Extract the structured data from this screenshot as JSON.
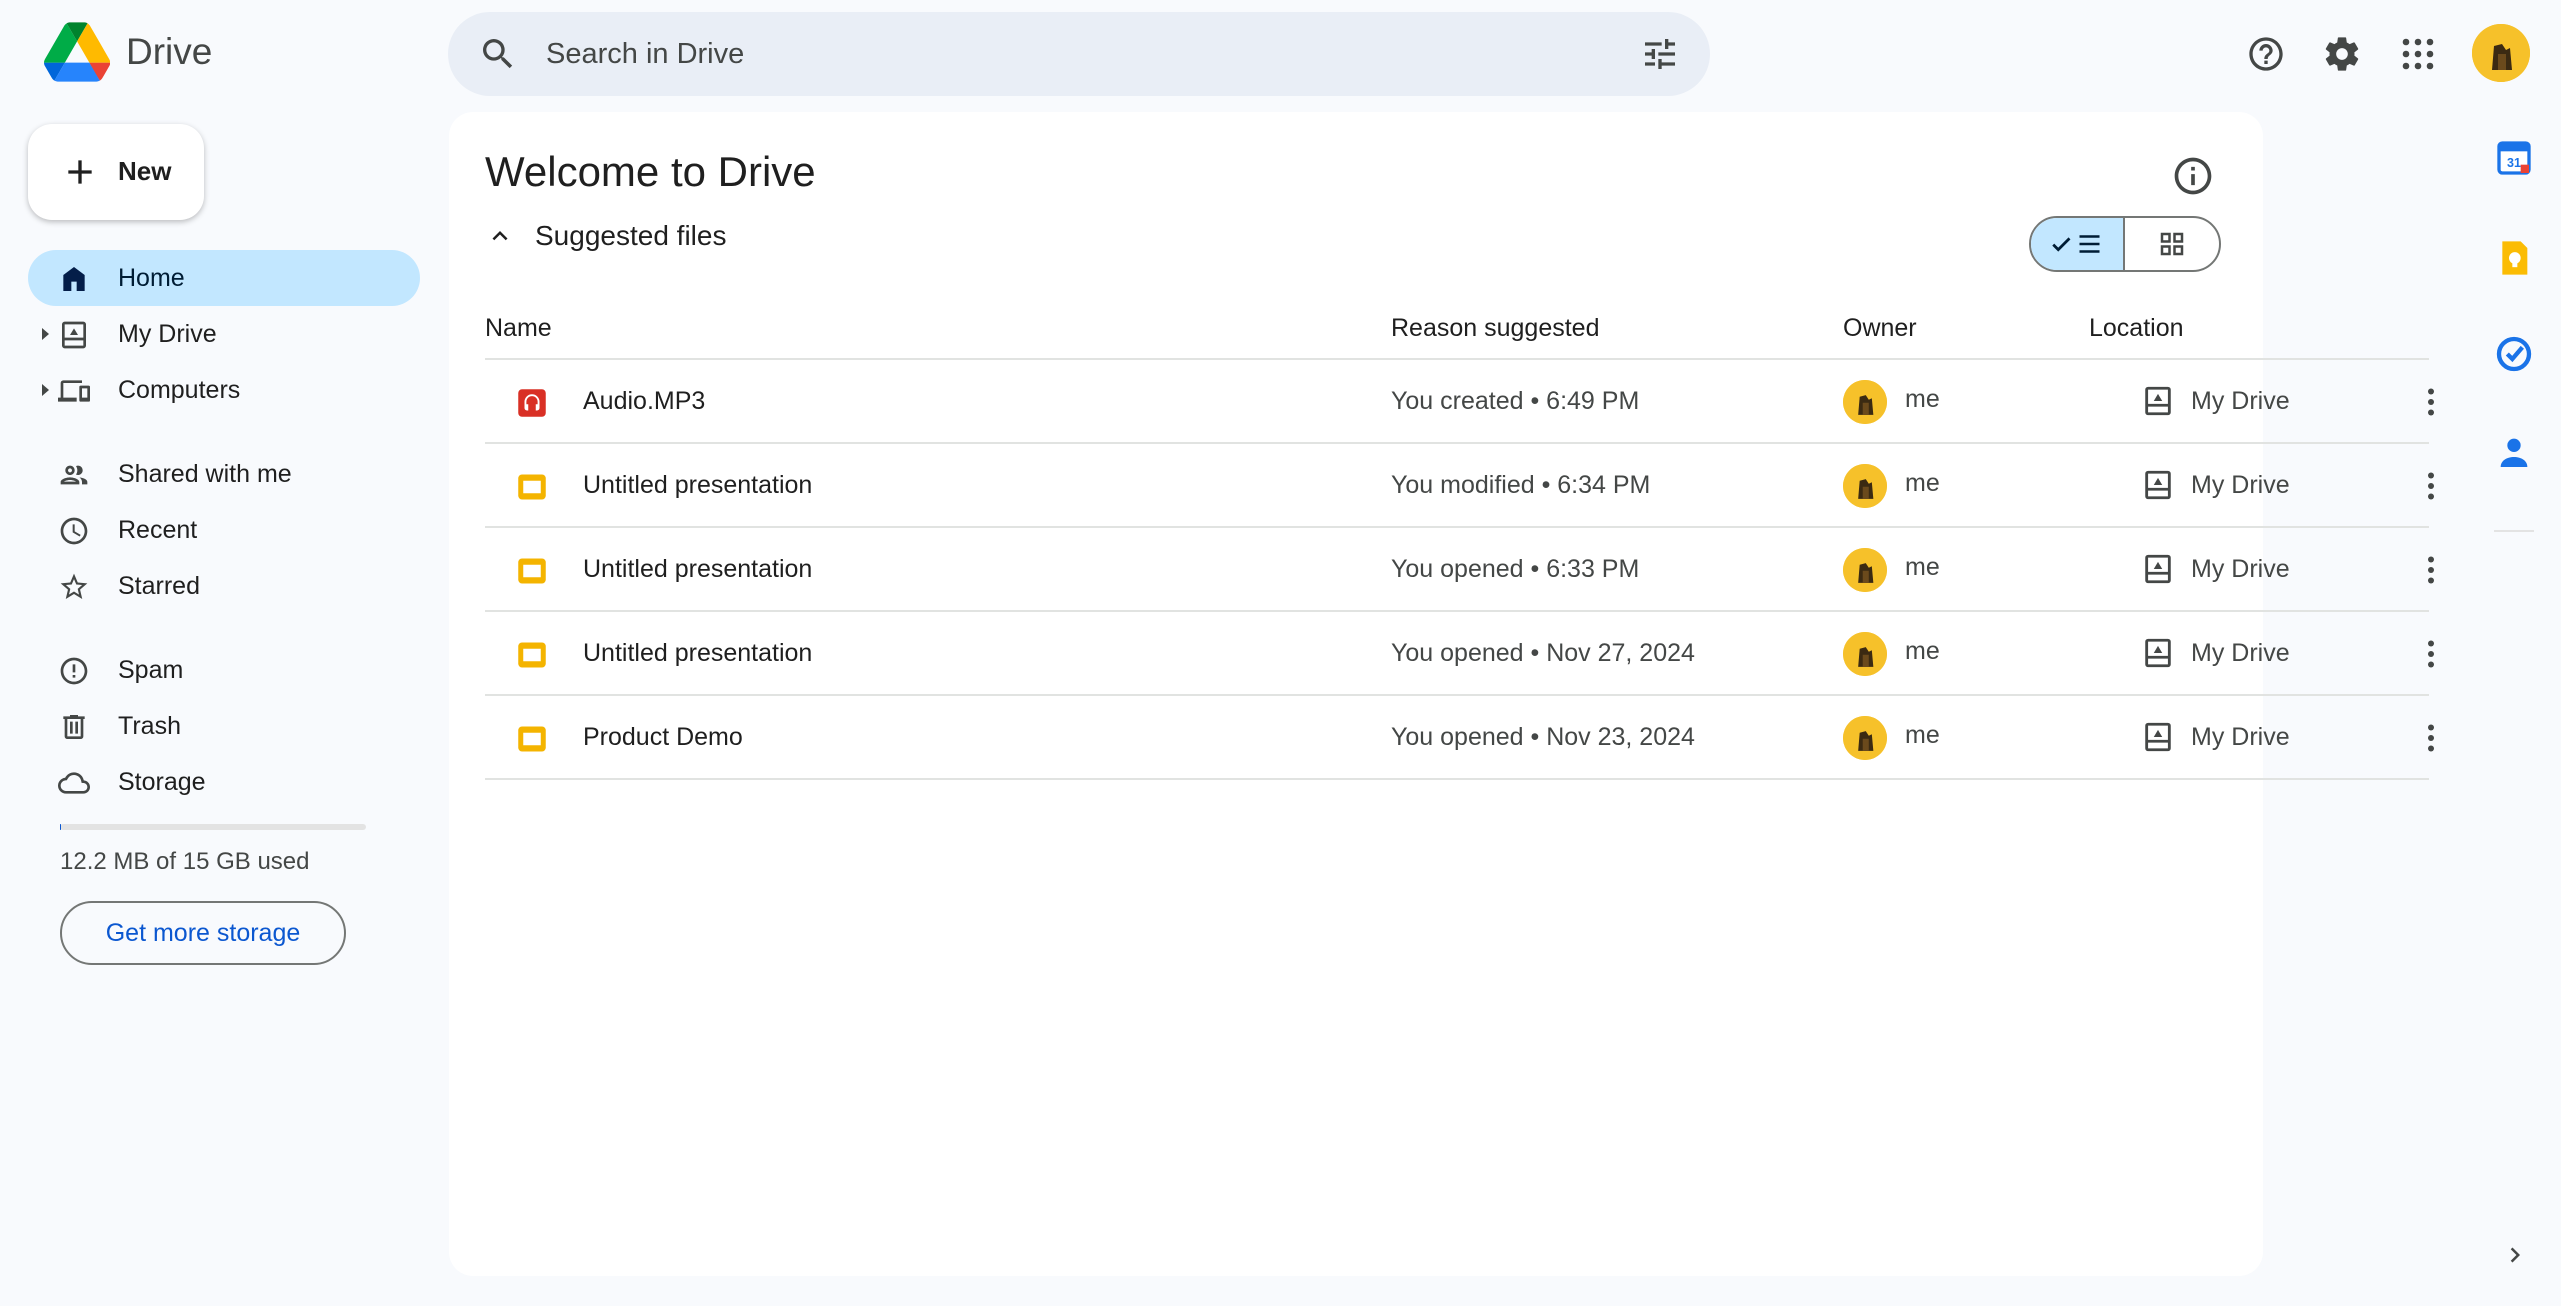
{
  "app": {
    "name": "Drive",
    "colors": {
      "accent": "#0b57d0",
      "active_nav": "#c2e7ff",
      "avatar": "#f6c12a",
      "audio_icon": "#d93025",
      "slides_icon": "#f4b400"
    }
  },
  "search": {
    "placeholder": "Search in Drive",
    "value": ""
  },
  "header_icons": [
    "help-icon",
    "settings-icon",
    "apps-grid-icon",
    "account-avatar"
  ],
  "sidebar": {
    "new_label": "New",
    "items": [
      {
        "label": "Home",
        "icon": "home-icon",
        "active": true
      },
      {
        "label": "My Drive",
        "icon": "my-drive-icon",
        "expandable": true
      },
      {
        "label": "Computers",
        "icon": "computers-icon",
        "expandable": true
      },
      {
        "label": "Shared with me",
        "icon": "shared-icon"
      },
      {
        "label": "Recent",
        "icon": "clock-icon"
      },
      {
        "label": "Starred",
        "icon": "star-icon"
      },
      {
        "label": "Spam",
        "icon": "spam-icon"
      },
      {
        "label": "Trash",
        "icon": "trash-icon"
      },
      {
        "label": "Storage",
        "icon": "cloud-icon"
      }
    ],
    "storage": {
      "used_text": "12.2 MB of 15 GB used",
      "fraction_used": 0.0008,
      "button_label": "Get more storage"
    }
  },
  "main": {
    "title": "Welcome to Drive",
    "section_label": "Suggested files",
    "view_mode": "list",
    "columns": [
      "Name",
      "Reason suggested",
      "Owner",
      "Location"
    ],
    "rows": [
      {
        "name": "Audio.MP3",
        "type": "audio",
        "reason": "You created • 6:49 PM",
        "owner": "me",
        "location": "My Drive"
      },
      {
        "name": "Untitled presentation",
        "type": "slides",
        "reason": "You modified • 6:34 PM",
        "owner": "me",
        "location": "My Drive"
      },
      {
        "name": "Untitled presentation",
        "type": "slides",
        "reason": "You opened • 6:33 PM",
        "owner": "me",
        "location": "My Drive"
      },
      {
        "name": "Untitled presentation",
        "type": "slides",
        "reason": "You opened • Nov 27, 2024",
        "owner": "me",
        "location": "My Drive"
      },
      {
        "name": "Product Demo",
        "type": "slides",
        "reason": "You opened • Nov 23, 2024",
        "owner": "me",
        "location": "My Drive"
      }
    ]
  },
  "right_rail": [
    "calendar-icon",
    "keep-icon",
    "tasks-icon",
    "contacts-icon"
  ]
}
